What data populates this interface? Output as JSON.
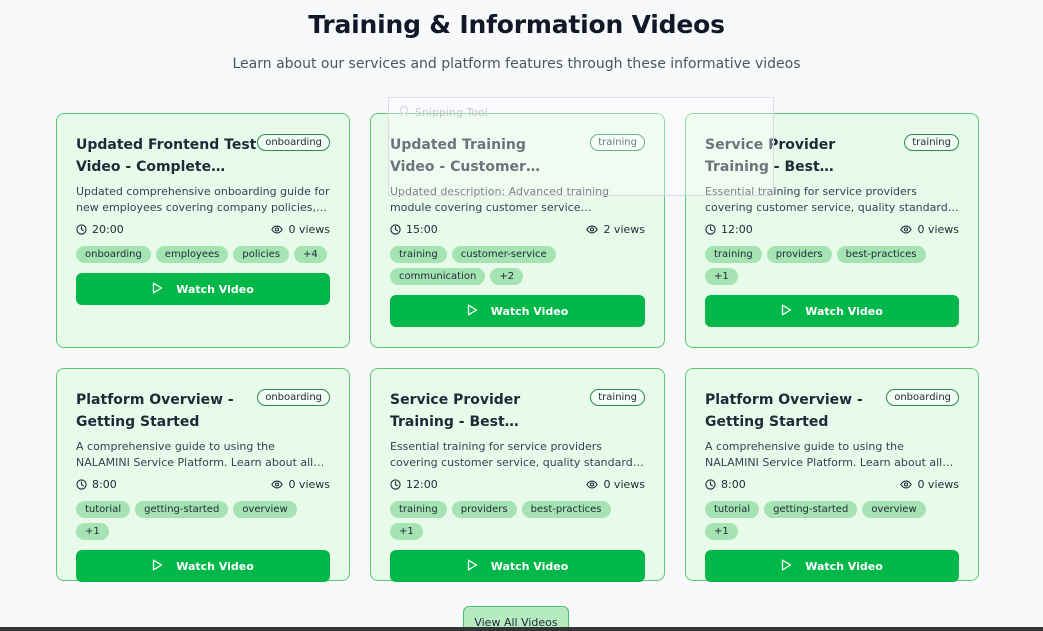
{
  "page": {
    "title": "Training & Information Videos",
    "subtitle": "Learn about our services and platform features through these informative videos"
  },
  "cards": [
    {
      "title": "Updated Frontend Test Video - Complete Employe...",
      "category": "onboarding",
      "description": "Updated comprehensive onboarding guide for new employees covering company policies, procedure...",
      "duration": "20:00",
      "views": "0 views",
      "tags": [
        "onboarding",
        "employees",
        "policies",
        "+4"
      ],
      "button": "Watch Video"
    },
    {
      "title": "Updated Training Video - Customer Service Excellence",
      "category": "training",
      "description": "Updated description: Advanced training module covering customer service excellence,...",
      "duration": "15:00",
      "views": "2 views",
      "tags": [
        "training",
        "customer-service",
        "communication",
        "+2"
      ],
      "button": "Watch Video"
    },
    {
      "title": "Service Provider Training - Best Practices",
      "category": "training",
      "description": "Essential training for service providers covering customer service, quality standards, and platform...",
      "duration": "12:00",
      "views": "0 views",
      "tags": [
        "training",
        "providers",
        "best-practices",
        "+1"
      ],
      "button": "Watch Video"
    },
    {
      "title": "Platform Overview - Getting Started",
      "category": "onboarding",
      "description": "A comprehensive guide to using the NALAMINI Service Platform. Learn about all available service...",
      "duration": "8:00",
      "views": "0 views",
      "tags": [
        "tutorial",
        "getting-started",
        "overview",
        "+1"
      ],
      "button": "Watch Video"
    },
    {
      "title": "Service Provider Training - Best Practices",
      "category": "training",
      "description": "Essential training for service providers covering customer service, quality standards, and platform...",
      "duration": "12:00",
      "views": "0 views",
      "tags": [
        "training",
        "providers",
        "best-practices",
        "+1"
      ],
      "button": "Watch Video"
    },
    {
      "title": "Platform Overview - Getting Started",
      "category": "onboarding",
      "description": "A comprehensive guide to using the NALAMINI Service Platform. Learn about all available service...",
      "duration": "8:00",
      "views": "0 views",
      "tags": [
        "tutorial",
        "getting-started",
        "overview",
        "+1"
      ],
      "button": "Watch Video"
    }
  ],
  "view_all_label": "View All Videos",
  "overlay": {
    "label": "Snipping Tool"
  },
  "icons": {
    "duration": "clock-icon",
    "views": "eye-icon",
    "play": "play-icon"
  },
  "colors": {
    "accent": "#00b849",
    "card_bg": "#e8fbea",
    "card_border": "#5cc876",
    "tag_bg": "#a5e4b2"
  }
}
